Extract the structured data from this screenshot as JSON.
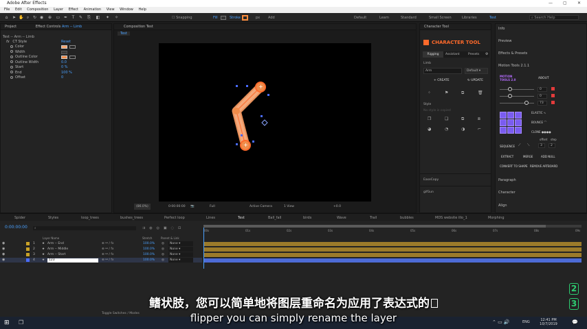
{
  "app": {
    "title": "Adobe After Effects"
  },
  "menu": [
    "File",
    "Edit",
    "Composition",
    "Layer",
    "Effect",
    "Animation",
    "View",
    "Window",
    "Help"
  ],
  "toolbar": {
    "snapping": "Snapping",
    "fill": "Fill",
    "stroke": "Stroke",
    "stroke_px": "px",
    "add": "Add",
    "workspaces": [
      "Default",
      "Learn",
      "Standard",
      "Small Screen",
      "Libraries",
      "Test"
    ],
    "search_placeholder": "Search Help"
  },
  "project_panel": {
    "tab": "Project",
    "effect_controls_tab": "Effect Controls",
    "effect_target": "Arm -- Limb"
  },
  "effect_controls": {
    "breadcrumb": "Test -- Arm -- Limb",
    "effect_name": "CT Style",
    "reset": "Reset",
    "props": [
      {
        "name": "Color",
        "value": ""
      },
      {
        "name": "Width",
        "value": ""
      },
      {
        "name": "Outline Color",
        "value": ""
      },
      {
        "name": "Outline Width",
        "value": "0.0"
      },
      {
        "name": "Start",
        "value": "0 %"
      },
      {
        "name": "End",
        "value": "100 %"
      },
      {
        "name": "Offset",
        "value": "0"
      }
    ]
  },
  "composition": {
    "tab": "Composition Test",
    "sub_tab": "Test",
    "zoom": "(86.0%)",
    "timecode": "0:00:00:00",
    "resolution": "Full",
    "camera": "Active Camera",
    "view": "1 View",
    "exposure": "+0.0"
  },
  "character_tool": {
    "panel_title": "Character Tool",
    "brand": "CHARACTER TOOL",
    "tabs": [
      "Rigging",
      "Assistant",
      "Presets"
    ],
    "limb_label": "Limb",
    "limb_value": "Arm",
    "preset_value": "Default",
    "create": "CREATE",
    "update": "UPDATE",
    "style_label": "Style",
    "style_hint": "No style is copied"
  },
  "side_panels": [
    "Info",
    "Preview",
    "Effects & Presets",
    "Motion Tools 2.1.1",
    "Paragraph",
    "Character",
    "Align"
  ],
  "lower_panels": [
    "EaseCopy",
    "gifGun"
  ],
  "motion_tools": {
    "logo": "MOTION TOOLS 2.0",
    "about": "ABOUT",
    "values": [
      "0",
      "0",
      "73"
    ],
    "elastic": "ELASTIC",
    "bounce": "BOUNCE",
    "clone": "CLONE",
    "offset": "offset",
    "step": "step",
    "sequence": "SEQUENCE",
    "seq_values": [
      "3",
      "2"
    ],
    "extract": "EXTRACT",
    "merge": "MERGE",
    "add_null": "ADD NULL",
    "convert": "CONVERT TO SHAPE",
    "remove_artboard": "REMOVE ARTBOARD"
  },
  "timeline_tabs": [
    "Spider",
    "Styles",
    "loop_trees",
    "bushes_trees",
    "Perfect loop",
    "Lines",
    "Test",
    "Ball_fall",
    "birds",
    "Wave",
    "Trail",
    "bubbles",
    "MDS website illo_1",
    "Morphing"
  ],
  "timeline": {
    "timecode": "0:00:00:00",
    "headers": {
      "layer_name": "Layer Name",
      "stretch": "Stretch",
      "parent": "Parent & Link"
    },
    "layers": [
      {
        "num": "1",
        "name": "Arm -- End",
        "stretch": "100.0%",
        "parent": "None"
      },
      {
        "num": "2",
        "name": "Arm -- Middle",
        "stretch": "100.0%",
        "parent": "None"
      },
      {
        "num": "3",
        "name": "Arm -- Start",
        "stretch": "100.0%",
        "parent": "None"
      },
      {
        "num": "4",
        "name": "123",
        "stretch": "100.0%",
        "parent": "None"
      }
    ],
    "ruler": [
      "00s",
      "01s",
      "02s",
      "03s",
      "04s",
      "05s",
      "06s",
      "07s",
      "08s",
      "09s"
    ],
    "bottom_label": "Toggle Switches / Modes"
  },
  "subtitles": {
    "cn": "鳍状肢，您可以简单地将图层重命名为应用了表达式的",
    "en": "flipper you can simply rename the layer"
  },
  "badges": [
    "2",
    "3"
  ],
  "taskbar": {
    "time": "12:41 PM",
    "date": "10/7/2019",
    "lang": "ENG"
  },
  "colors": {
    "accent": "#4aa1ff",
    "orange": "#ff6a2b",
    "limb": "#f4a26b"
  }
}
